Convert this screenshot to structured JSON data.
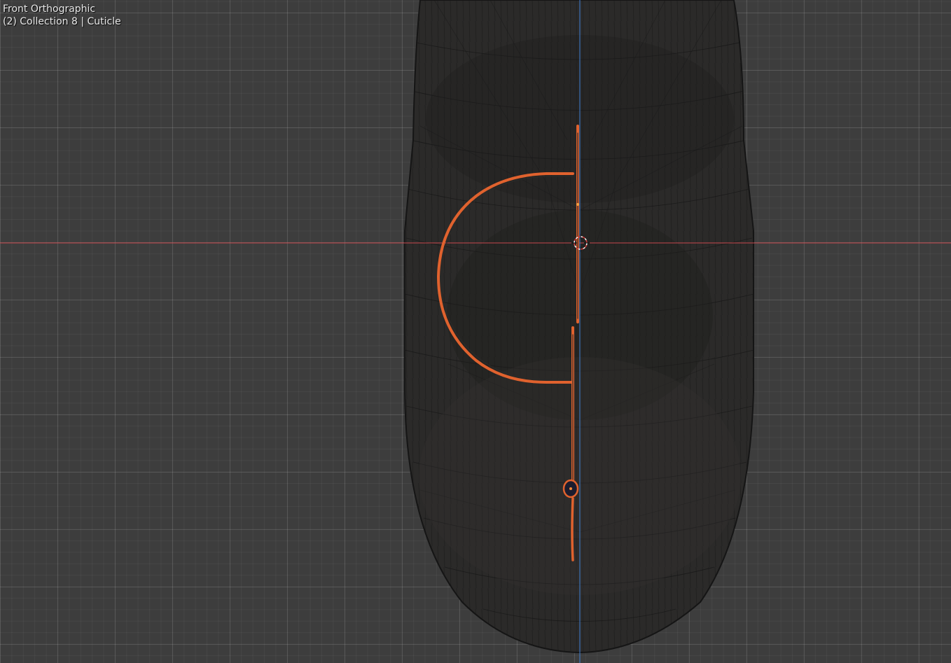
{
  "viewport": {
    "view_name": "Front Orthographic",
    "object_info": "(2) Collection 8 | Cuticle"
  },
  "colors": {
    "background": "#3d3d3d",
    "x_axis": "#c8484d",
    "z_axis": "#3f7fd2",
    "selection": "#e0622e",
    "wire": "#121212"
  },
  "icons": {
    "cursor": "3d-cursor-icon",
    "origin": "object-origin-icon"
  }
}
